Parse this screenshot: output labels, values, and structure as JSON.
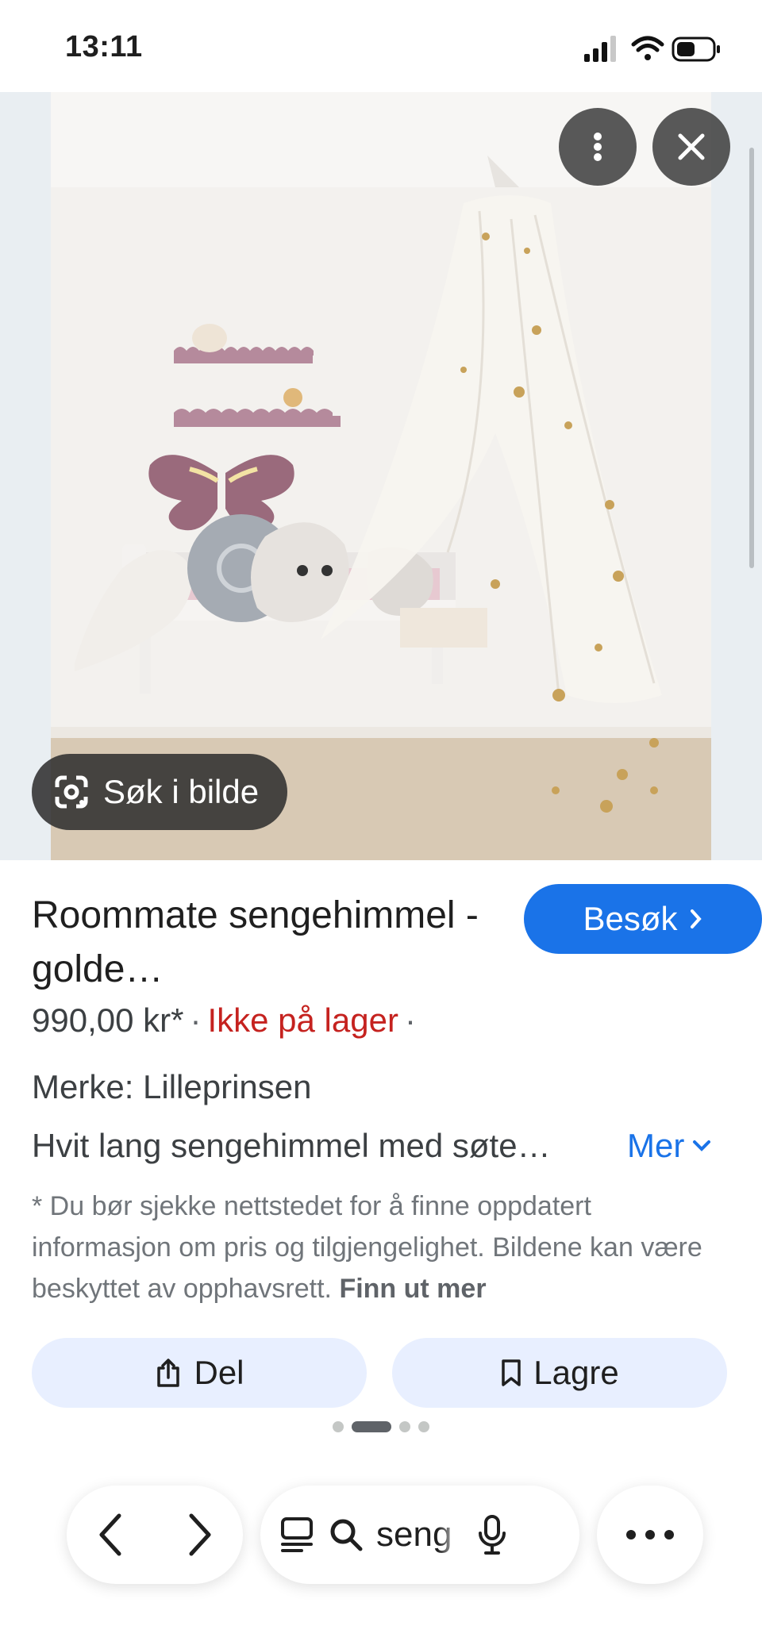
{
  "status_bar": {
    "time": "13:11",
    "icons": [
      "cellular-signal-icon",
      "wifi-icon",
      "battery-icon"
    ]
  },
  "image_viewer": {
    "photo_description_icon": "canopy-product-photo",
    "lens_button_label": "Søk i bilde",
    "more_options_icon": "more-vertical-icon",
    "close_icon": "close-icon"
  },
  "product": {
    "title": "Roommate sengehimmel - golde…",
    "visit_label": "Besøk",
    "price": "990,00 kr*",
    "availability": "Ikke på lager",
    "brand": "Merke: Lilleprinsen",
    "description": "Hvit lang sengehimmel med søte…",
    "more_label": "Mer",
    "disclaimer": "* Du bør sjekke nettstedet for å finne oppdatert informasjon om pris og tilgjengelighet. Bildene kan være beskyttet av opphavsrett.",
    "learn_more_label": "Finn ut mer"
  },
  "actions": {
    "share_label": "Del",
    "save_label": "Lagre"
  },
  "pager": {
    "count": 4,
    "active_index": 1
  },
  "browser_bar": {
    "search_text": "seng",
    "icons": [
      "back-icon",
      "forward-icon",
      "tabs-icon",
      "search-icon",
      "microphone-icon",
      "more-horizontal-icon"
    ]
  },
  "colors": {
    "accent_blue": "#1a73e8",
    "out_of_stock_red": "#c5221f",
    "action_button_bg": "#e8efff"
  }
}
